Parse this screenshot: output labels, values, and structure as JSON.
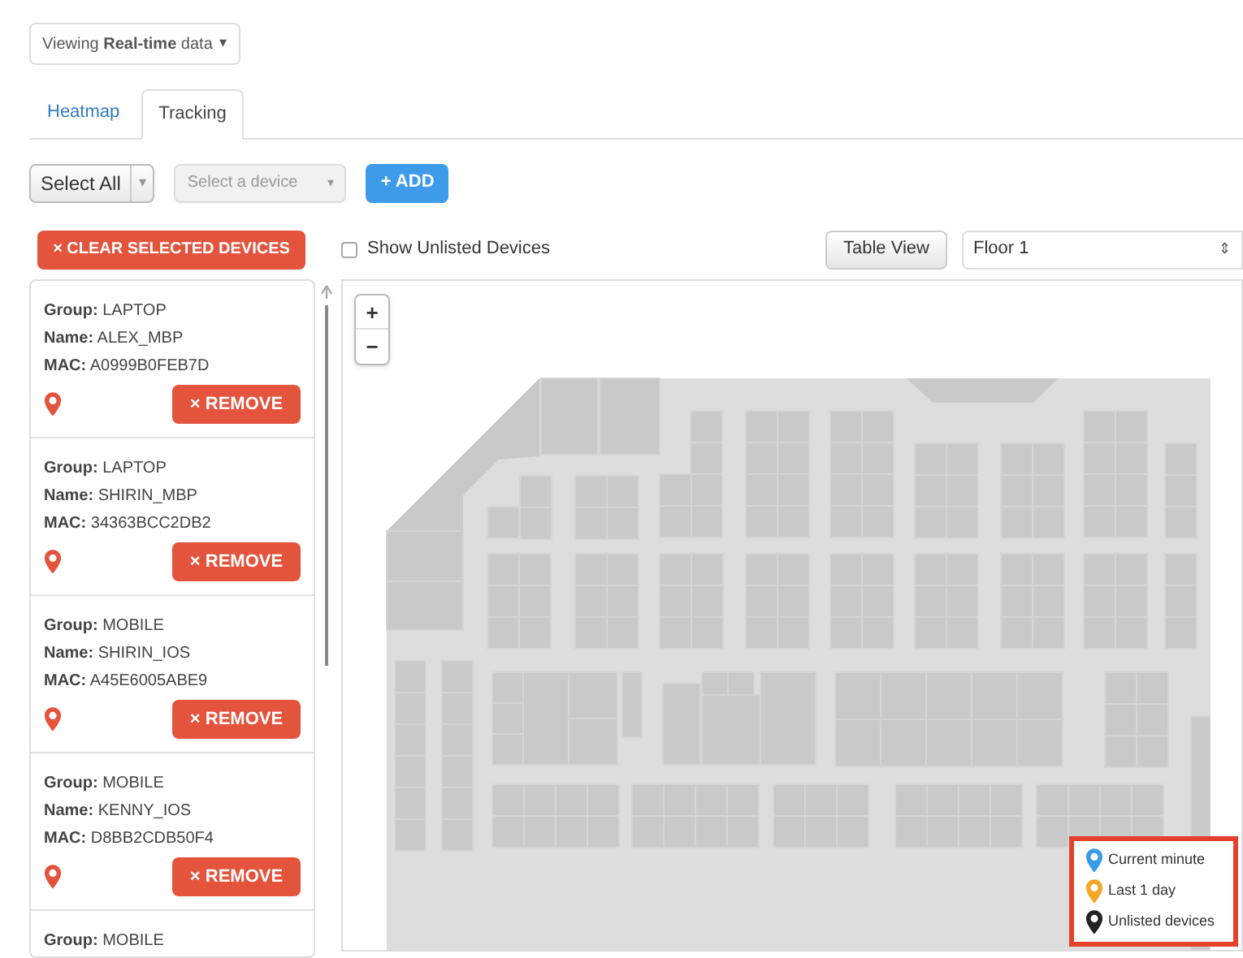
{
  "view_selector": {
    "text": "Viewing **Real-time** data",
    "caret": "▾"
  },
  "tabs": [
    {
      "label": "Heatmap",
      "selected": false
    },
    {
      "label": "Tracking",
      "selected": true
    }
  ],
  "toolbar": {
    "select_all": {
      "label": "Select All",
      "caret": "▾"
    },
    "device_select": {
      "placeholder": "Select a device",
      "caret": "▾",
      "disabled": true
    },
    "add_button": "+ ADD"
  },
  "actions": {
    "clear_button": "× CLEAR SELECTED DEVICES",
    "show_unlisted": {
      "label": "Show Unlisted Devices",
      "checked": false
    },
    "table_view_button": "Table View",
    "floor_select": {
      "value": "Floor 1",
      "caret": "⇕"
    }
  },
  "devices": [
    {
      "lines": [
        "**Group:** LAPTOP",
        "**Name:** ALEX_MBP",
        "**MAC:** A0999B0FEB7D"
      ],
      "remove": "× REMOVE"
    },
    {
      "lines": [
        "**Group:** LAPTOP",
        "**Name:** SHIRIN_MBP",
        "**MAC:** 34363BCC2DB2"
      ],
      "remove": "× REMOVE"
    },
    {
      "lines": [
        "**Group:** MOBILE",
        "**Name:** SHIRIN_IOS",
        "**MAC:** A45E6005ABE9"
      ],
      "remove": "× REMOVE"
    },
    {
      "lines": [
        "**Group:** MOBILE",
        "**Name:** KENNY_IOS",
        "**MAC:** D8BB2CDB50F4"
      ],
      "remove": "× REMOVE"
    },
    {
      "lines": [
        "**Group:** MOBILE"
      ]
    }
  ],
  "map": {
    "zoom_in": "+",
    "zoom_out": "−",
    "legend": [
      {
        "label": "Current minute",
        "color": "#3b9be8"
      },
      {
        "label": "Last 1 day",
        "color": "#f5a623"
      },
      {
        "label": "Unlisted devices",
        "color": "#222222"
      }
    ]
  }
}
